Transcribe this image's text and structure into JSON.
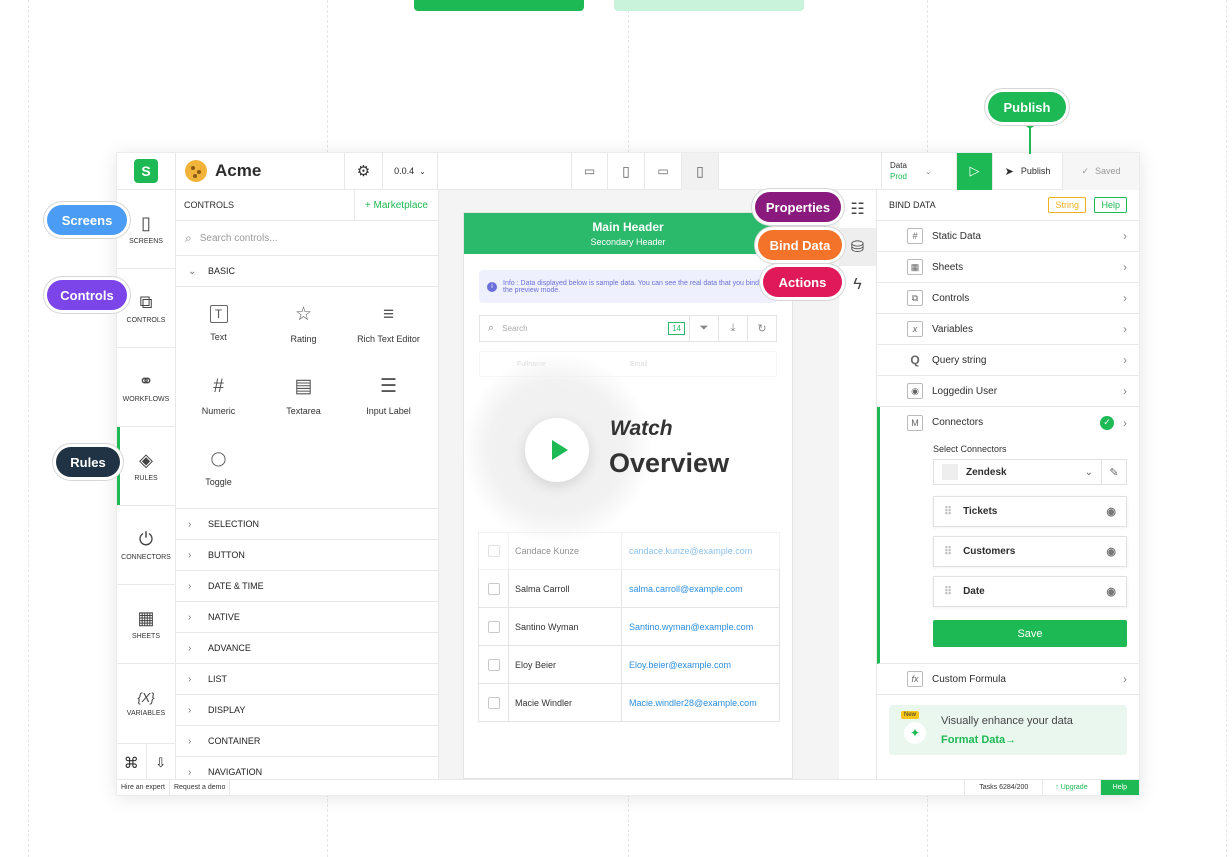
{
  "callouts": {
    "publish": "Publish",
    "screens": "Screens",
    "controls": "Controls",
    "rules": "Rules",
    "properties": "Properties",
    "bind_data": "Bind Data",
    "actions": "Actions"
  },
  "colors": {
    "brand": "#1db954",
    "screens_callout": "#4a9cf5",
    "controls_callout": "#7b45ea",
    "rules_callout": "#1f3345",
    "properties_callout": "#8a1a7d",
    "bind_data_callout": "#f4732a",
    "actions_callout": "#e01a5a"
  },
  "topbar": {
    "logo_letter": "S",
    "app_name": "Acme",
    "version": "0.0.4",
    "data_label": "Data",
    "data_env": "Prod",
    "publish": "Publish",
    "saved": "Saved"
  },
  "sidebar": [
    {
      "label": "SCREENS",
      "icon": "screens-icon",
      "glyph": "▯"
    },
    {
      "label": "CONTROLS",
      "icon": "controls-icon",
      "glyph": "⧉"
    },
    {
      "label": "WORKFLOWS",
      "icon": "workflows-icon",
      "glyph": "⚭"
    },
    {
      "label": "RULES",
      "icon": "rules-icon",
      "glyph": "◈"
    },
    {
      "label": "CONNECTORS",
      "icon": "connectors-icon",
      "glyph": "⏻"
    },
    {
      "label": "SHEETS",
      "icon": "sheets-icon",
      "glyph": "▦"
    },
    {
      "label": "VARIABLES",
      "icon": "variables-icon",
      "glyph": "{x}"
    }
  ],
  "controls_panel": {
    "title": "CONTROLS",
    "marketplace": "+ Marketplace",
    "search_placeholder": "Search controls...",
    "basic": "BASIC",
    "items": [
      {
        "label": "Text",
        "glyph": "T",
        "icon": "text-icon"
      },
      {
        "label": "Rating",
        "glyph": "☆",
        "icon": "rating-icon"
      },
      {
        "label": "Rich Text Editor",
        "glyph": "≡",
        "icon": "rich-text-icon"
      },
      {
        "label": "Numeric",
        "glyph": "#",
        "icon": "numeric-icon"
      },
      {
        "label": "Textarea",
        "glyph": "▤",
        "icon": "textarea-icon"
      },
      {
        "label": "Input Label",
        "glyph": "☰",
        "icon": "input-label-icon"
      },
      {
        "label": "Toggle",
        "glyph": "◯",
        "icon": "toggle-icon"
      }
    ],
    "categories": [
      "SELECTION",
      "BUTTON",
      "DATE & TIME",
      "NATIVE",
      "ADVANCE",
      "LIST",
      "DISPLAY",
      "CONTAINER",
      "NAVIGATION"
    ]
  },
  "phone": {
    "main_header": "Main Header",
    "secondary_header": "Secondary Header",
    "info": "Info : Data displayed below is sample data. You can see the real data that you bind in the preview mode.",
    "search_placeholder": "Search",
    "count": "14",
    "col_name": "Fullname",
    "col_email": "Email",
    "rows": [
      {
        "name": "Candace Kunze",
        "email": "candace.kunze@example.com"
      },
      {
        "name": "Salma Carroll",
        "email": "salma.carroll@example.com"
      },
      {
        "name": "Santino Wyman",
        "email": "Santino.wyman@example.com"
      },
      {
        "name": "Eloy Beier",
        "email": "Eloy.beier@example.com"
      },
      {
        "name": "Macie Windler",
        "email": "Macie.windler28@example.com"
      }
    ]
  },
  "video": {
    "watch": "Watch",
    "overview": "Overview"
  },
  "bind": {
    "title": "BIND DATA",
    "string_tag": "String",
    "help_tag": "Help",
    "rows": [
      {
        "label": "Static Data",
        "glyph": "#"
      },
      {
        "label": "Sheets",
        "glyph": "▦"
      },
      {
        "label": "Controls",
        "glyph": "⧉"
      },
      {
        "label": "Variables",
        "glyph": "x"
      },
      {
        "label": "Query string",
        "glyph": "Q"
      },
      {
        "label": "Loggedin User",
        "glyph": "◉"
      }
    ],
    "connectors": "Connectors",
    "select_connectors": "Select Connectors",
    "connector_value": "Zendesk",
    "fields": [
      "Tickets",
      "Customers",
      "Date"
    ],
    "save": "Save",
    "custom_formula": "Custom Formula",
    "promo_new": "New",
    "promo_text": "Visually enhance your data",
    "promo_link": "Format Data→"
  },
  "footer": {
    "hire": "Hire an expert",
    "demo": "Request a demo",
    "tasks": "Tasks 6284/200",
    "upgrade": "↑ Upgrade",
    "help": "Help"
  }
}
